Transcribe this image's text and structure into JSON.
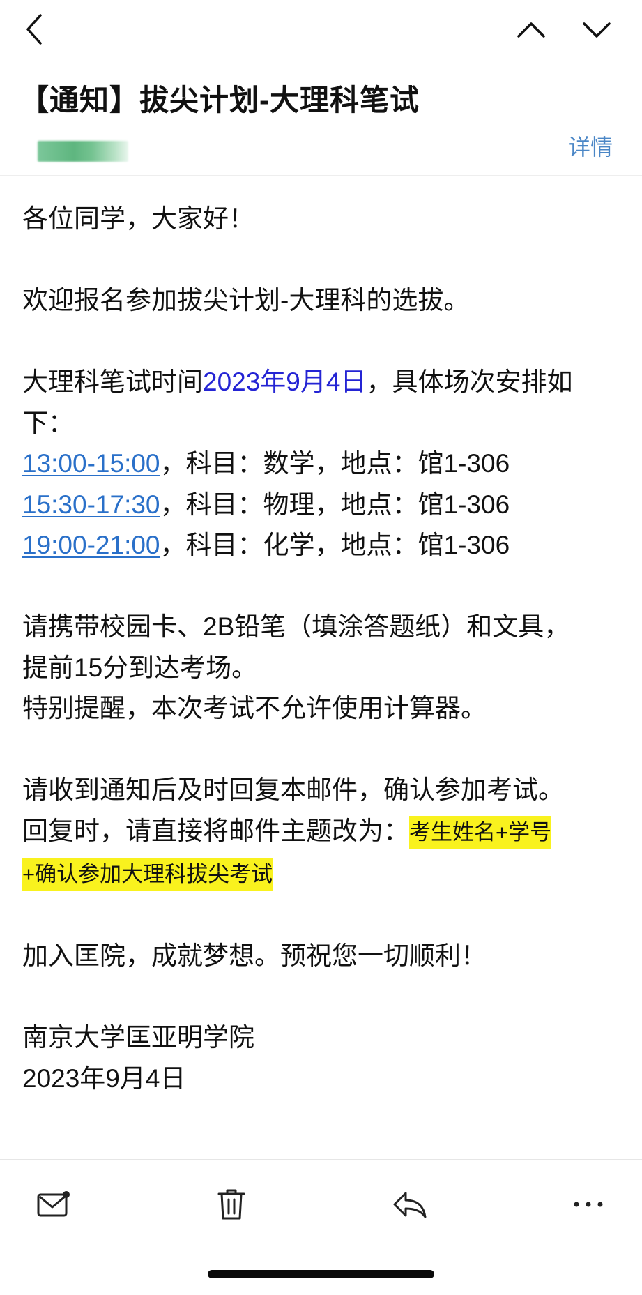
{
  "header": {
    "subject": "【通知】拔尖计划-大理科笔试",
    "details_label": "详情"
  },
  "body": {
    "greeting": "各位同学，大家好！",
    "welcome": "欢迎报名参加拔尖计划-大理科的选拔。",
    "schedule_intro_prefix": "大理科笔试时间",
    "schedule_date": "2023年9月4日",
    "schedule_intro_suffix": "，具体场次安排如",
    "schedule_intro_tail": "下：",
    "sessions": [
      {
        "time": "13:00-15:00",
        "detail": "，科目：数学，地点：馆1-306"
      },
      {
        "time": "15:30-17:30",
        "detail": "，科目：物理，地点：馆1-306"
      },
      {
        "time": "19:00-21:00",
        "detail": "，科目：化学，地点：馆1-306"
      }
    ],
    "bring_line1": "请携带校园卡、2B铅笔（填涂答题纸）和文具，",
    "bring_line2": "提前15分到达考场。",
    "reminder": "特别提醒，本次考试不允许使用计算器。",
    "reply_line1": "请收到通知后及时回复本邮件，确认参加考试。",
    "reply_line2_prefix": "回复时，请直接将邮件主题改为：",
    "reply_highlight1": "考生姓名+学号",
    "reply_highlight2": "+确认参加大理科拔尖考试",
    "closing": "加入匡院，成就梦想。预祝您一切顺利！",
    "signature_org": "南京大学匡亚明学院",
    "signature_date": "2023年9月4日"
  },
  "colors": {
    "link_blue": "#2a70c9",
    "date_blue": "#2424d4",
    "highlight_yellow": "#f9f21e",
    "details_blue": "#4a86c6"
  },
  "icons": {
    "back": "chevron-left-icon",
    "prev": "chevron-up-icon",
    "next": "chevron-down-icon",
    "mark_unread": "mail-unread-icon",
    "delete": "trash-icon",
    "reply": "reply-icon",
    "more": "more-icon"
  }
}
